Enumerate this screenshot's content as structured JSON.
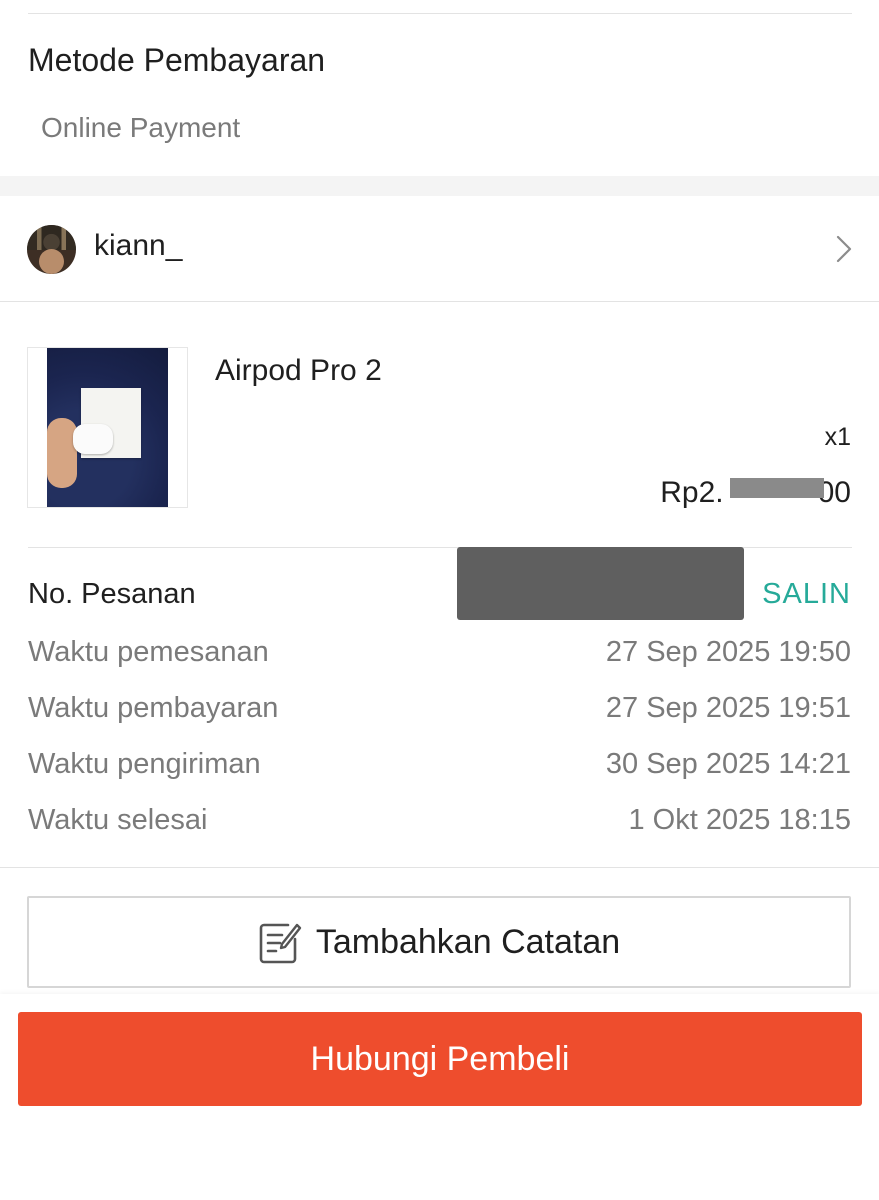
{
  "payment": {
    "title": "Metode Pembayaran",
    "method": "Online Payment"
  },
  "buyer": {
    "username": "kiann_",
    "chevron_icon": "chevron-right-icon"
  },
  "product": {
    "name": "Airpod Pro 2",
    "quantity": "x1",
    "price_visible": "Rp2.",
    "price_suffix": "00"
  },
  "order": {
    "number_label": "No. Pesanan",
    "copy_label": "SALIN",
    "rows": [
      {
        "label": "Waktu pemesanan",
        "value": "27 Sep 2025 19:50"
      },
      {
        "label": "Waktu pembayaran",
        "value": "27 Sep 2025 19:51"
      },
      {
        "label": "Waktu pengiriman",
        "value": "30 Sep 2025 14:21"
      },
      {
        "label": "Waktu selesai",
        "value": "1 Okt 2025 18:15"
      }
    ]
  },
  "actions": {
    "add_note_label": "Tambahkan Catatan",
    "contact_buyer_label": "Hubungi Pembeli"
  },
  "colors": {
    "accent": "#ee4d2d",
    "copy_text": "#26aa99",
    "secondary_text": "#7a7a7a",
    "divider": "#e3e3e3"
  }
}
